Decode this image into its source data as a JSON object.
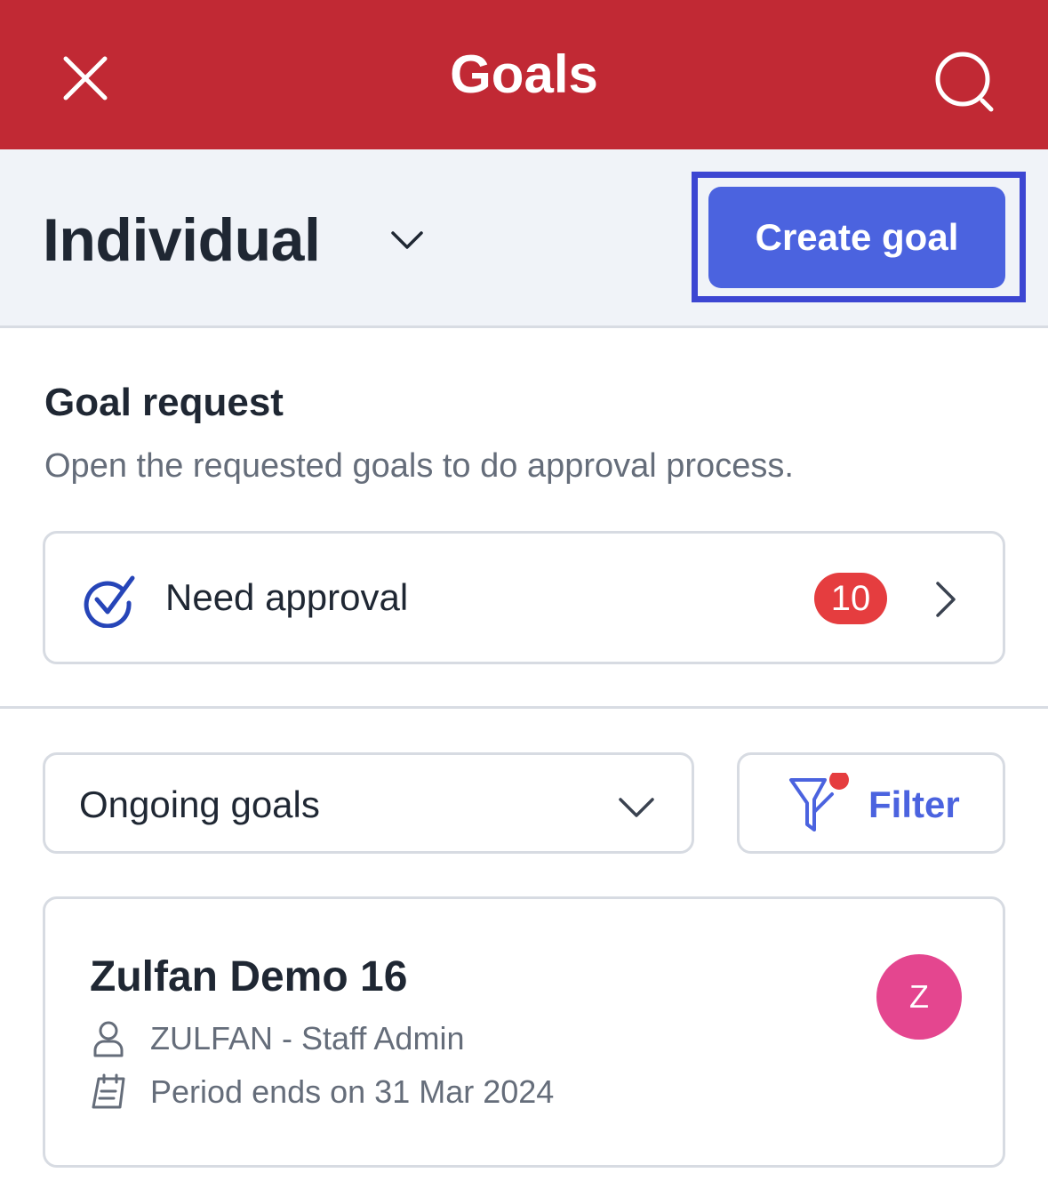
{
  "header": {
    "title": "Goals",
    "close_icon": "close-icon",
    "search_icon": "search-icon",
    "background_color": "#c12934"
  },
  "subheader": {
    "type_selected": "Individual",
    "create_label": "Create goal",
    "accent_color": "#4b63df"
  },
  "goal_request": {
    "title": "Goal request",
    "description": "Open the requested goals to do approval process.",
    "approval": {
      "label": "Need approval",
      "count": "10"
    }
  },
  "filters": {
    "status_selected": "Ongoing goals",
    "filter_label": "Filter",
    "filter_active": true
  },
  "goals": [
    {
      "title": "Zulfan Demo 16",
      "owner": "ZULFAN - Staff Admin",
      "period": "Period ends on 31 Mar 2024",
      "avatar_initial": "Z",
      "avatar_color": "#e4468f"
    }
  ]
}
